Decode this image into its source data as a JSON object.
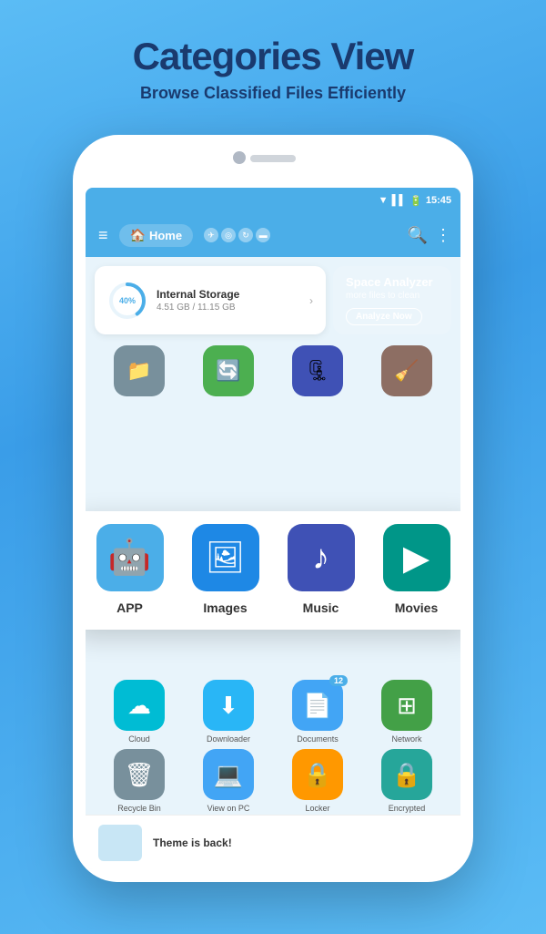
{
  "header": {
    "title": "Categories View",
    "subtitle": "Browse Classified Files Efficiently"
  },
  "status_bar": {
    "time": "15:45"
  },
  "nav": {
    "home_label": "Home"
  },
  "storage": {
    "percent": "40%",
    "title": "Internal Storage",
    "used": "4.51 GB / 11.15 GB"
  },
  "analyzer": {
    "title": "Space Analyzer",
    "subtitle": "more files to clean",
    "button": "Analyze Now"
  },
  "popup_icons": [
    {
      "label": "APP",
      "emoji": "🤖",
      "color": "bg-blue-light"
    },
    {
      "label": "Images",
      "emoji": "🖼️",
      "color": "bg-blue"
    },
    {
      "label": "Music",
      "emoji": "🎵",
      "color": "bg-indigo"
    },
    {
      "label": "Movies",
      "emoji": "▶",
      "color": "bg-teal"
    }
  ],
  "small_icons_row1": [
    {
      "label": "Cloud",
      "emoji": "☁",
      "color": "bg-cyan",
      "badge": null
    },
    {
      "label": "Downloader",
      "emoji": "⬇",
      "color": "bg-blue",
      "badge": null
    },
    {
      "label": "Documents",
      "emoji": "📄",
      "color": "bg-blue",
      "badge": "12"
    },
    {
      "label": "Network",
      "emoji": "⊞",
      "color": "bg-green2",
      "badge": null
    }
  ],
  "small_icons_row2": [
    {
      "label": "Recycle Bin",
      "emoji": "🗑",
      "color": "bg-gray",
      "badge": null
    },
    {
      "label": "View on PC",
      "emoji": "💻",
      "color": "bg-blue",
      "badge": null
    },
    {
      "label": "Locker",
      "emoji": "🔒",
      "color": "bg-orange",
      "badge": null
    },
    {
      "label": "Encrypted",
      "emoji": "🔒",
      "color": "bg-teal2",
      "badge": null
    }
  ],
  "bottom_card": {
    "text": "Theme is back!"
  }
}
